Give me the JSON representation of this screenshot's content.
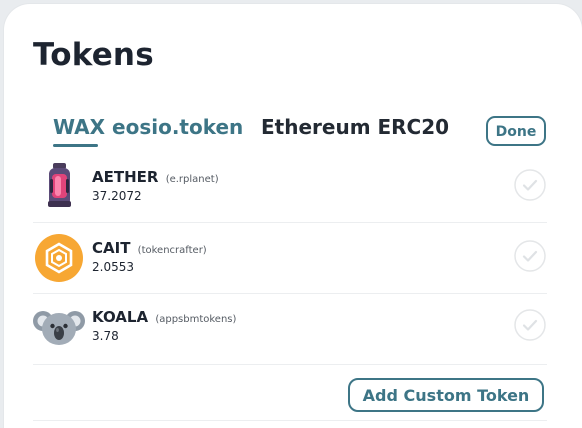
{
  "header": {
    "title": "Tokens"
  },
  "tabs": [
    {
      "label": "WAX eosio.token",
      "active": true
    },
    {
      "label": "Ethereum ERC20",
      "active": false
    }
  ],
  "done_label": "Done",
  "tokens": [
    {
      "symbol": "AETHER",
      "contract": "(e.rplanet)",
      "balance": "37.2072",
      "icon": "aether-canister-icon",
      "selected": false
    },
    {
      "symbol": "CAIT",
      "contract": "(tokencrafter)",
      "balance": "2.0553",
      "icon": "cait-hexagon-icon",
      "selected": false
    },
    {
      "symbol": "KOALA",
      "contract": "(appsbmtokens)",
      "balance": "3.78",
      "icon": "koala-face-icon",
      "selected": false
    }
  ],
  "add_custom_label": "Add Custom Token",
  "colors": {
    "accent": "#3d7586",
    "cait_orange": "#f7a733",
    "text": "#1d2430"
  }
}
